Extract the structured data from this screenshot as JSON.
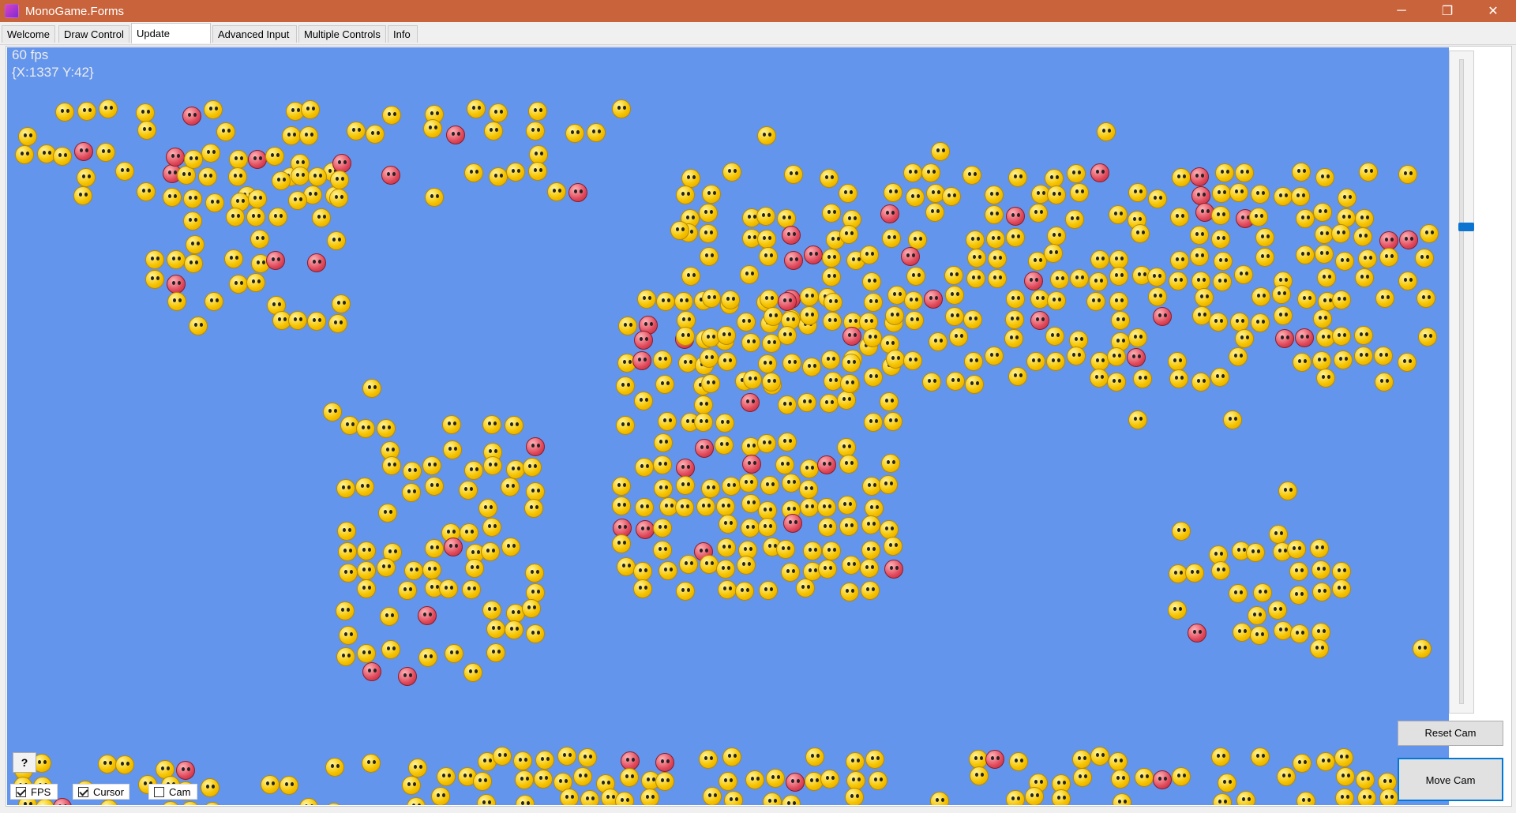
{
  "window": {
    "title": "MonoGame.Forms",
    "controls": {
      "minimize": "─",
      "restore": "❐",
      "close": "✕"
    }
  },
  "tabs": [
    {
      "label": "Welcome",
      "active": false
    },
    {
      "label": "Draw Control",
      "active": false
    },
    {
      "label": "Update Control",
      "active": true
    },
    {
      "label": "Advanced Input",
      "active": false
    },
    {
      "label": "Multiple Controls",
      "active": false
    },
    {
      "label": "Info",
      "active": false
    }
  ],
  "viewport": {
    "fps": "60 fps",
    "cursor": "{X:1337 Y:42}",
    "background": "#6495ed"
  },
  "buttons": {
    "reset_cam": "Reset Cam",
    "move_cam": "Move Cam",
    "help": "?"
  },
  "checkboxes": [
    {
      "label": "FPS",
      "checked": true
    },
    {
      "label": "Cursor",
      "checked": true
    },
    {
      "label": "Cam",
      "checked": false
    }
  ],
  "zoom_slider": {
    "value_fraction": 0.74
  },
  "colors": {
    "accent": "#0078d7",
    "titlebar": "#c9633b",
    "emoji_happy": "#f6c400",
    "emoji_angry": "#e0485a"
  }
}
